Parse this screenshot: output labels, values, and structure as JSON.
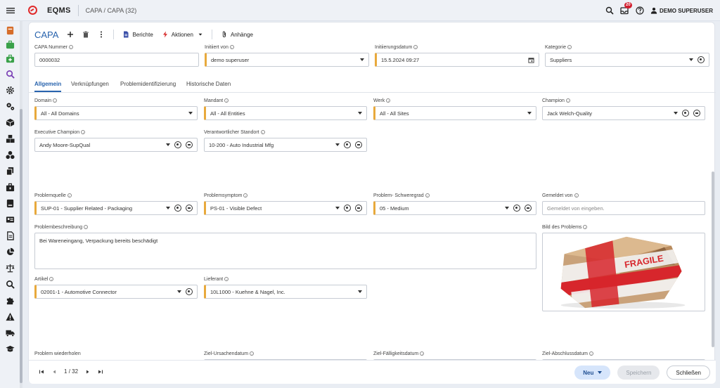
{
  "header": {
    "app_name": "EQMS",
    "breadcrumb": "CAPA / CAPA (32)",
    "notification_count": "20",
    "user_name": "DEMO SUPERUSER"
  },
  "toolbar": {
    "title": "CAPA",
    "reports_label": "Berichte",
    "actions_label": "Aktionen",
    "attachments_label": "Anhänge"
  },
  "top_fields": {
    "capa_number": {
      "label": "CAPA Nummer",
      "value": "0000032"
    },
    "initiated_by": {
      "label": "Initiiert von",
      "value": "demo superuser"
    },
    "initiation_date": {
      "label": "Initiierungsdatum",
      "value": "15.5.2024 09:27"
    },
    "category": {
      "label": "Kategorie",
      "value": "Suppliers"
    }
  },
  "tabs": [
    {
      "label": "Allgemein"
    },
    {
      "label": "Verknüpfungen"
    },
    {
      "label": "Problemidentifizierung"
    },
    {
      "label": "Historische Daten"
    }
  ],
  "general": {
    "domain": {
      "label": "Domain",
      "value": "All - All Domains"
    },
    "client": {
      "label": "Mandant",
      "value": "All - All Entities"
    },
    "plant": {
      "label": "Werk",
      "value": "All - All Sites"
    },
    "champion": {
      "label": "Champion",
      "value": "Jack Welch-Quality"
    },
    "executive_champion": {
      "label": "Executive Champion",
      "value": "Andy Moore-SupQual"
    },
    "responsible_site": {
      "label": "Verantwortlicher Standort",
      "value": "10-200 - Auto Industrial Mfg"
    },
    "problem_source": {
      "label": "Problemquelle",
      "value": "SUP-01 - Supplier Related - Packaging"
    },
    "problem_symptom": {
      "label": "Problemsymptom",
      "value": "PS-01 - Visible Defect"
    },
    "problem_severity": {
      "label": "Problem- Schweregrad",
      "value": "05 - Medium"
    },
    "reported_by": {
      "label": "Gemeldet von",
      "placeholder": "Gemeldet von eingeben."
    },
    "problem_description": {
      "label": "Problembeschreibung",
      "value": "Bei Wareneingang, Verpackung bereits beschädigt"
    },
    "problem_image": {
      "label": "Bild des Problems",
      "tape_text": "FRAGILE"
    },
    "article": {
      "label": "Artikel",
      "value": "02001-1 - Automotive Connector"
    },
    "supplier": {
      "label": "Lieferant",
      "value": "10L1000 - Kuehne & Nagel, Inc."
    },
    "problem_repeat": {
      "label": "Problem wiederholen"
    },
    "target_cause_date": {
      "label": "Ziel-Ursachendatum"
    },
    "target_due_date": {
      "label": "Ziel-Fälligkeitsdatum"
    },
    "target_closing_date": {
      "label": "Ziel-Abschlussdatum"
    }
  },
  "footer": {
    "page_current": "1",
    "page_sep": "/",
    "page_total": "32",
    "new_label": "Neu",
    "save_label": "Speichern",
    "close_label": "Schließen"
  },
  "colors": {
    "accent": "#2863ad",
    "required": "#e8a93c",
    "badge": "#d11f2f"
  }
}
